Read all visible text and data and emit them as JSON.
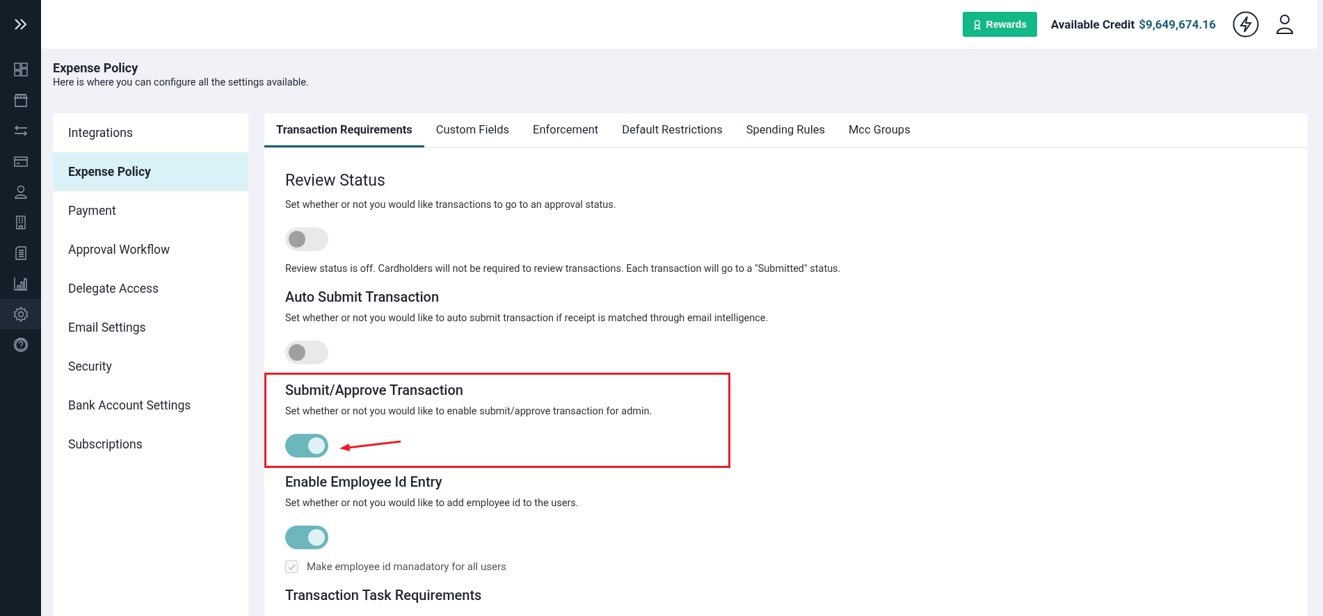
{
  "header": {
    "rewards_button": "Rewards",
    "credit_label": "Available Credit",
    "credit_value": "$9,649,674.16"
  },
  "nav": {
    "items": [
      {
        "selected": false
      },
      {
        "selected": false
      },
      {
        "selected": false
      },
      {
        "selected": false
      },
      {
        "selected": false
      },
      {
        "selected": false
      },
      {
        "selected": false
      },
      {
        "selected": false
      },
      {
        "selected": true
      },
      {
        "selected": false
      }
    ]
  },
  "page": {
    "title": "Expense Policy",
    "subtitle": "Here is where you can configure all the settings available."
  },
  "settings_menu": [
    {
      "label": "Integrations",
      "selected": false
    },
    {
      "label": "Expense Policy",
      "selected": true
    },
    {
      "label": "Payment",
      "selected": false
    },
    {
      "label": "Approval Workflow",
      "selected": false
    },
    {
      "label": "Delegate Access",
      "selected": false
    },
    {
      "label": "Email Settings",
      "selected": false
    },
    {
      "label": "Security",
      "selected": false
    },
    {
      "label": "Bank Account Settings",
      "selected": false
    },
    {
      "label": "Subscriptions",
      "selected": false
    }
  ],
  "tabs": [
    {
      "label": "Transaction Requirements",
      "selected": true
    },
    {
      "label": "Custom Fields",
      "selected": false
    },
    {
      "label": "Enforcement",
      "selected": false
    },
    {
      "label": "Default Restrictions",
      "selected": false
    },
    {
      "label": "Spending Rules",
      "selected": false
    },
    {
      "label": "Mcc Groups",
      "selected": false
    }
  ],
  "sections": [
    {
      "kind": "major",
      "title": "Review Status",
      "description": "Set whether or not you would like transactions to go to an approval status.",
      "on": false,
      "highlighted": false,
      "note": "Review status is off. Cardholders will not be required to review transactions. Each transaction will go to a \"Submitted\" status."
    },
    {
      "kind": "toggle",
      "title": "Auto Submit Transaction",
      "description": "Set whether or not you would like to auto submit transaction if receipt is matched through email intelligence.",
      "on": false,
      "highlighted": false
    },
    {
      "kind": "toggle",
      "title": "Submit/Approve Transaction",
      "description": "Set whether or not you would like to enable submit/approve transaction for admin.",
      "on": true,
      "highlighted": true
    },
    {
      "kind": "toggle",
      "title": "Enable Employee Id Entry",
      "description": "Set whether or not you would like to add employee id to the users.",
      "on": true,
      "highlighted": false,
      "checkbox": {
        "label": "Make employee id manadatory for all users",
        "checked": true,
        "disabled": true
      }
    },
    {
      "kind": "heading",
      "title": "Transaction Task Requirements"
    }
  ]
}
